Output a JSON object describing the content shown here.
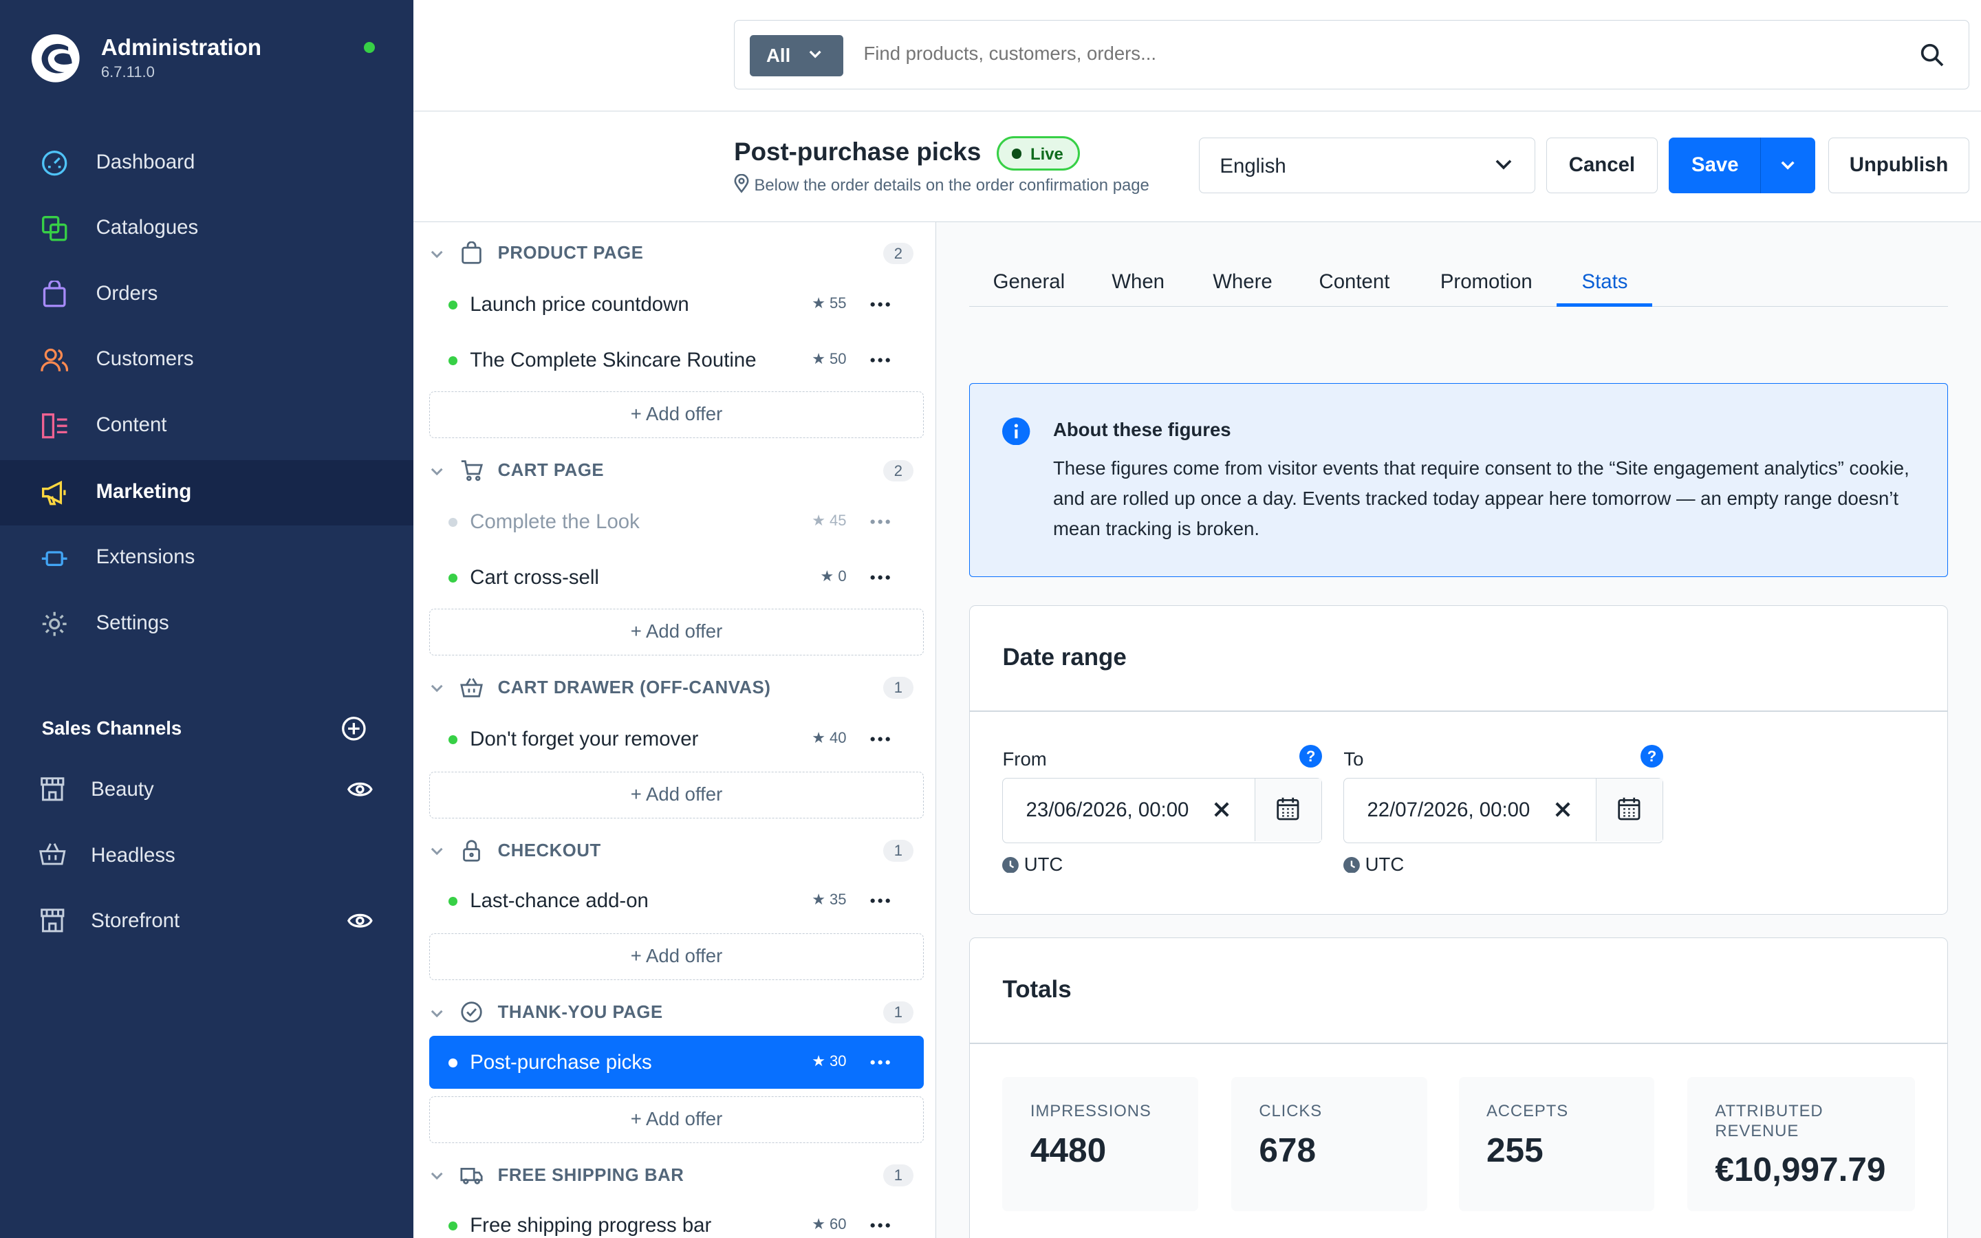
{
  "app": {
    "title": "Administration",
    "version": "6.7.11.0"
  },
  "nav": [
    {
      "label": "Dashboard",
      "icon": "gauge-icon",
      "color": "#4fc3f7"
    },
    {
      "label": "Catalogues",
      "icon": "copy-icon",
      "color": "#37d046"
    },
    {
      "label": "Orders",
      "icon": "bag-icon",
      "color": "#a78bfa"
    },
    {
      "label": "Customers",
      "icon": "users-icon",
      "color": "#ff8a50"
    },
    {
      "label": "Content",
      "icon": "content-icon",
      "color": "#f06292"
    },
    {
      "label": "Marketing",
      "icon": "megaphone-icon",
      "color": "#ffd740",
      "active": true
    },
    {
      "label": "Extensions",
      "icon": "plug-icon",
      "color": "#42a5f5"
    },
    {
      "label": "Settings",
      "icon": "gear-icon",
      "color": "#b0bec5"
    }
  ],
  "sales_channels": {
    "heading": "Sales Channels",
    "items": [
      {
        "label": "Beauty",
        "icon": "storefront-icon",
        "visible_toggle": true
      },
      {
        "label": "Headless",
        "icon": "basket-icon",
        "visible_toggle": false
      },
      {
        "label": "Storefront",
        "icon": "storefront-icon",
        "visible_toggle": true
      }
    ]
  },
  "search": {
    "scope": "All",
    "placeholder": "Find products, customers, orders..."
  },
  "page": {
    "title": "Post-purchase picks",
    "status": "Live",
    "subtitle": "Below the order details on the order confirmation page",
    "language": "English",
    "cancel": "Cancel",
    "save": "Save",
    "unpublish": "Unpublish"
  },
  "sections": [
    {
      "title": "PRODUCT PAGE",
      "count": "2",
      "icon": "bag-icon",
      "items": [
        {
          "name": "Launch price countdown",
          "rating": "★ 55",
          "active": true
        },
        {
          "name": "The Complete Skincare Routine",
          "rating": "★ 50",
          "active": true
        }
      ]
    },
    {
      "title": "CART PAGE",
      "count": "2",
      "icon": "cart-icon",
      "items": [
        {
          "name": "Complete the Look",
          "rating": "★ 45",
          "active": false
        },
        {
          "name": "Cart cross-sell",
          "rating": "★ 0",
          "active": true
        }
      ]
    },
    {
      "title": "CART DRAWER (OFF-CANVAS)",
      "count": "1",
      "icon": "basket-icon",
      "items": [
        {
          "name": "Don't forget your remover",
          "rating": "★ 40",
          "active": true
        }
      ]
    },
    {
      "title": "CHECKOUT",
      "count": "1",
      "icon": "lock-icon",
      "items": [
        {
          "name": "Last-chance add-on",
          "rating": "★ 35",
          "active": true
        }
      ]
    },
    {
      "title": "THANK-YOU PAGE",
      "count": "1",
      "icon": "check-circle-icon",
      "items": [
        {
          "name": "Post-purchase picks",
          "rating": "★ 30",
          "active": true,
          "selected": true
        }
      ]
    },
    {
      "title": "FREE SHIPPING BAR",
      "count": "1",
      "icon": "truck-icon",
      "items": [
        {
          "name": "Free shipping progress bar",
          "rating": "★ 60",
          "active": true
        }
      ]
    }
  ],
  "add_offer": "+ Add offer",
  "tabs": [
    "General",
    "When",
    "Where",
    "Content",
    "Promotion",
    "Stats"
  ],
  "active_tab": "Stats",
  "info": {
    "title": "About these figures",
    "body": "These figures come from visitor events that require consent to the “Site engagement analytics” cookie, and are rolled up once a day. Events tracked today appear here tomorrow — an empty range doesn’t mean tracking is broken."
  },
  "date_range": {
    "title": "Date range",
    "from_label": "From",
    "from_value": "23/06/2026, 00:00",
    "to_label": "To",
    "to_value": "22/07/2026, 00:00",
    "timezone": "UTC",
    "help": "?"
  },
  "totals": {
    "title": "Totals",
    "stats": [
      {
        "label": "IMPRESSIONS",
        "value": "4480"
      },
      {
        "label": "CLICKS",
        "value": "678"
      },
      {
        "label": "ACCEPTS",
        "value": "255"
      },
      {
        "label": "ATTRIBUTED REVENUE",
        "value": "€10,997.79"
      }
    ]
  }
}
